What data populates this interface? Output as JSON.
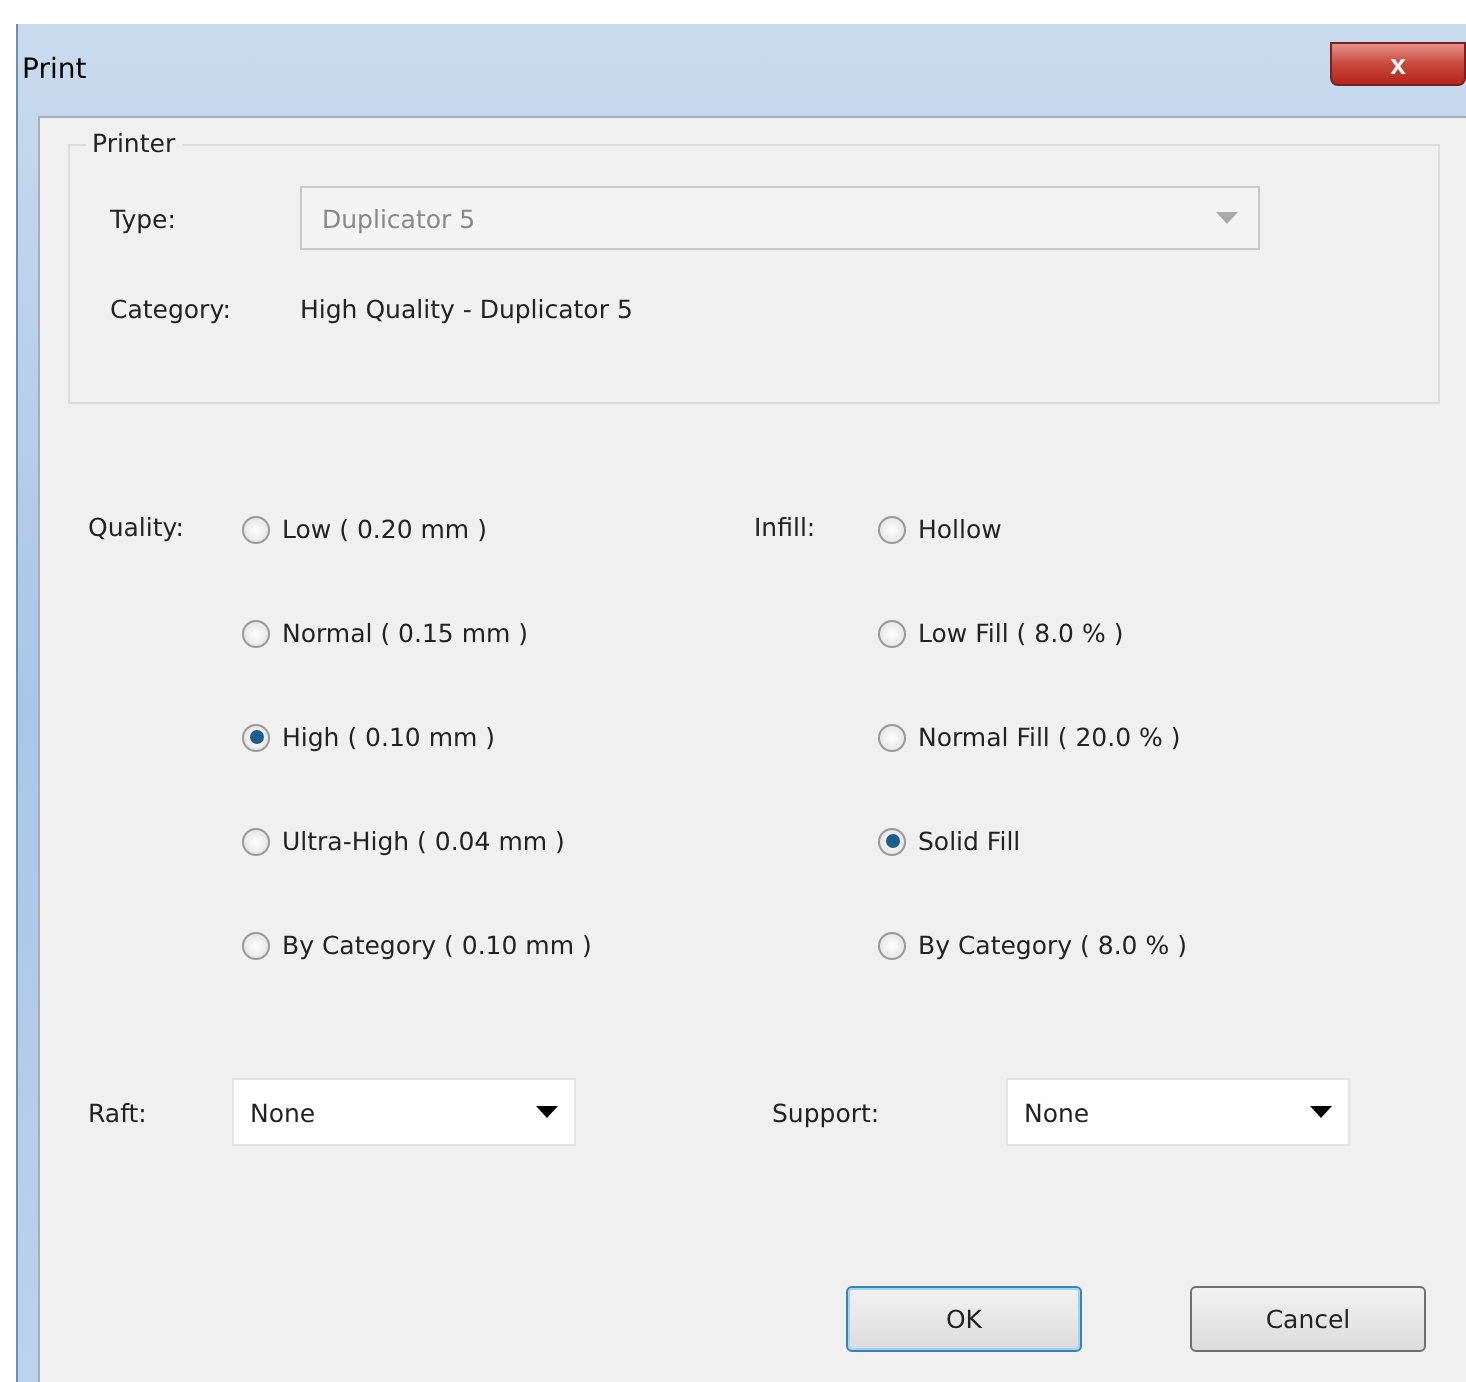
{
  "window": {
    "title": "Print",
    "close": "x"
  },
  "printer": {
    "legend": "Printer",
    "type_label": "Type:",
    "type_value": "Duplicator 5",
    "type_disabled": true,
    "category_label": "Category:",
    "category_value": "High Quality - Duplicator 5"
  },
  "quality": {
    "label": "Quality:",
    "options": [
      {
        "label": "Low ( 0.20 mm )",
        "selected": false
      },
      {
        "label": "Normal ( 0.15 mm )",
        "selected": false
      },
      {
        "label": "High ( 0.10 mm )",
        "selected": true
      },
      {
        "label": "Ultra-High ( 0.04 mm )",
        "selected": false
      },
      {
        "label": "By Category ( 0.10 mm )",
        "selected": false
      }
    ]
  },
  "infill": {
    "label": "Infill:",
    "options": [
      {
        "label": "Hollow",
        "selected": false
      },
      {
        "label": "Low Fill ( 8.0 % )",
        "selected": false
      },
      {
        "label": "Normal Fill ( 20.0 % )",
        "selected": false
      },
      {
        "label": "Solid Fill",
        "selected": true
      },
      {
        "label": "By Category ( 8.0 % )",
        "selected": false
      }
    ]
  },
  "raft": {
    "label": "Raft:",
    "value": "None"
  },
  "support": {
    "label": "Support:",
    "value": "None"
  },
  "buttons": [
    {
      "label": "OK",
      "default": true
    },
    {
      "label": "Cancel",
      "default": false
    }
  ]
}
